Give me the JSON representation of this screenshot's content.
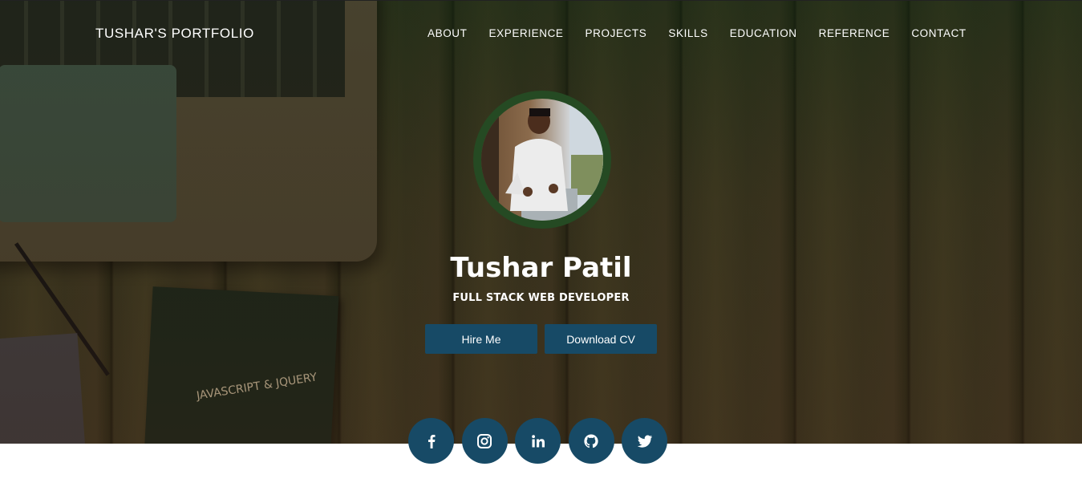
{
  "brand": {
    "title": "TUSHAR'S PORTFOLIO"
  },
  "nav": {
    "items": [
      "ABOUT",
      "EXPERIENCE",
      "PROJECTS",
      "SKILLS",
      "EDUCATION",
      "REFERENCE",
      "CONTACT"
    ]
  },
  "hero": {
    "name": "Tushar Patil",
    "role": "FULL STACK WEB DEVELOPER",
    "hire_label": "Hire Me",
    "cv_label": "Download CV",
    "book_label": "JAVASCRIPT & JQUERY"
  },
  "socials": [
    {
      "icon": "facebook-icon"
    },
    {
      "icon": "instagram-icon"
    },
    {
      "icon": "linkedin-icon"
    },
    {
      "icon": "github-icon"
    },
    {
      "icon": "twitter-icon"
    }
  ],
  "colors": {
    "accent": "#174a66",
    "avatar_ring": "#254a23",
    "text": "#ffffff"
  }
}
